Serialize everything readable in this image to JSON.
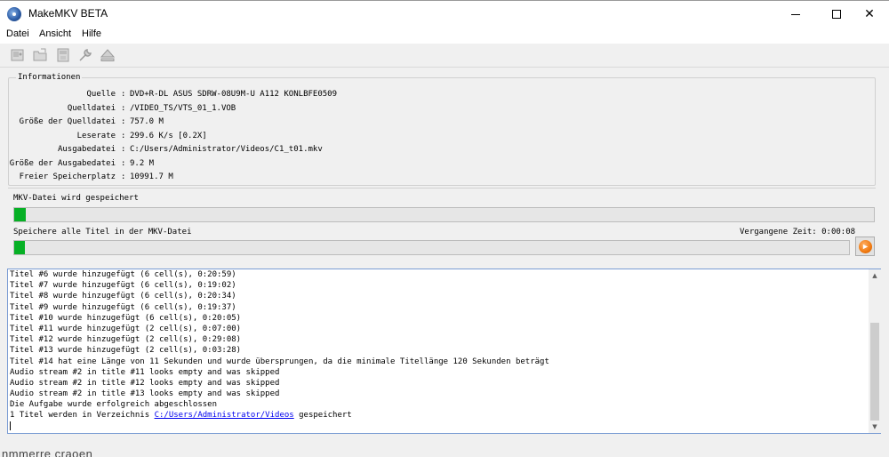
{
  "window": {
    "title": "MakeMKV BETA"
  },
  "menu": {
    "items": [
      "Datei",
      "Ansicht",
      "Hilfe"
    ]
  },
  "toolbar": {
    "buttons": [
      "open-disc-icon",
      "open-files-icon",
      "backup-icon",
      "settings-icon",
      "eject-icon"
    ]
  },
  "info": {
    "legend": "Informationen",
    "rows": [
      {
        "label": "Quelle",
        "value": "DVD+R-DL ASUS SDRW-08U9M-U A112 KONLBFE0509"
      },
      {
        "label": "Quelldatei",
        "value": "/VIDEO_TS/VTS_01_1.VOB"
      },
      {
        "label": "Größe der Quelldatei",
        "value": "757.0 M"
      },
      {
        "label": "Leserate",
        "value": "299.6 K/s [0.2X]"
      },
      {
        "label": "Ausgabedatei",
        "value": "C:/Users/Administrator/Videos/C1_t01.mkv"
      },
      {
        "label": "Größe der Ausgabedatei",
        "value": "9.2 M"
      },
      {
        "label": "Freier Speicherplatz",
        "value": "10991.7 M"
      }
    ]
  },
  "progress": {
    "current_label": "MKV-Datei wird gespeichert",
    "current_fraction": 0.013,
    "total_label": "Speichere alle Titel in der MKV-Datei",
    "total_fraction": 0.013,
    "elapsed_label": "Vergangene Zeit: 0:00:08"
  },
  "log": {
    "lines": [
      "Titel #6 wurde hinzugefügt (6 cell(s), 0:20:59)",
      "Titel #7 wurde hinzugefügt (6 cell(s), 0:19:02)",
      "Titel #8 wurde hinzugefügt (6 cell(s), 0:20:34)",
      "Titel #9 wurde hinzugefügt (6 cell(s), 0:19:37)",
      "Titel #10 wurde hinzugefügt (6 cell(s), 0:20:05)",
      "Titel #11 wurde hinzugefügt (2 cell(s), 0:07:00)",
      "Titel #12 wurde hinzugefügt (2 cell(s), 0:29:08)",
      "Titel #13 wurde hinzugefügt (2 cell(s), 0:03:28)",
      "Titel #14 hat eine Länge von 11 Sekunden und wurde übersprungen, da die minimale Titellänge 120 Sekunden beträgt",
      "Audio stream #2 in title #11 looks empty and was skipped",
      "Audio stream #2 in title #12 looks empty and was skipped",
      "Audio stream #2 in title #13 looks empty and was skipped",
      "Die Aufgabe wurde erfolgreich abgeschlossen"
    ],
    "final_prefix": "1 Titel werden in Verzeichnis ",
    "final_link": "C:/Users/Administrator/Videos",
    "final_suffix": " gespeichert"
  },
  "background": {
    "partial_text": "nmmerre craoen"
  }
}
